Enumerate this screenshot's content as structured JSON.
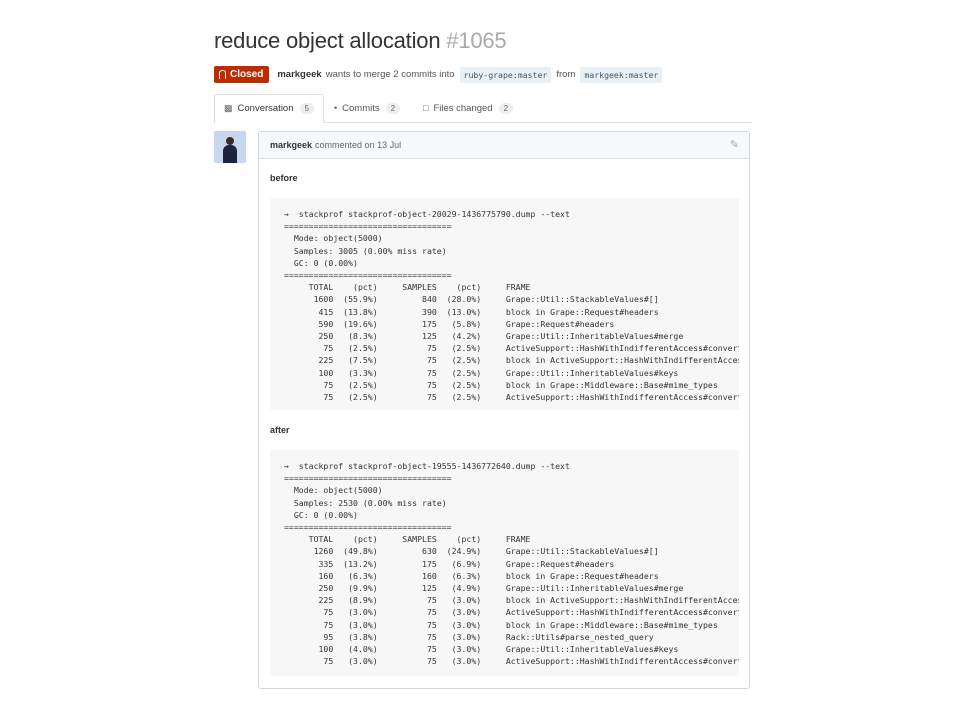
{
  "pr": {
    "title": "reduce object allocation",
    "number": "#1065",
    "state": "Closed",
    "author": "markgeek",
    "action_text": "wants to merge 2 commits into",
    "base_branch": "ruby-grape:master",
    "from_text": "from",
    "head_branch": "markgeek:master"
  },
  "tabs": [
    {
      "icon": "conversation-icon",
      "label": "Conversation",
      "count": "5"
    },
    {
      "icon": "commits-icon",
      "label": "Commits",
      "count": "2"
    },
    {
      "icon": "files-changed-icon",
      "label": "Files changed",
      "count": "2"
    }
  ],
  "comment": {
    "author": "markgeek",
    "date_text": "commented on 13 Jul",
    "before_label": "before",
    "after_label": "after",
    "before_code": "→  stackprof stackprof-object-20029-1436775790.dump --text\n==================================\n  Mode: object(5000)\n  Samples: 3005 (0.00% miss rate)\n  GC: 0 (0.00%)\n==================================\n     TOTAL    (pct)     SAMPLES    (pct)     FRAME\n      1600  (55.9%)         840  (28.0%)     Grape::Util::StackableValues#[]\n       415  (13.8%)         390  (13.0%)     block in Grape::Request#headers\n       590  (19.6%)         175   (5.8%)     Grape::Request#headers\n       250   (8.3%)         125   (4.2%)     Grape::Util::InheritableValues#merge\n        75   (2.5%)          75   (2.5%)     ActiveSupport::HashWithIndifferentAccess#convert_key\n       225   (7.5%)          75   (2.5%)     block in ActiveSupport::HashWithIndifferentAccess#update\n       100   (3.3%)          75   (2.5%)     Grape::Util::InheritableValues#keys\n        75   (2.5%)          75   (2.5%)     block in Grape::Middleware::Base#mime_types\n        75   (2.5%)          75   (2.5%)     ActiveSupport::HashWithIndifferentAccess#convert_value",
    "after_code": "→  stackprof stackprof-object-19555-1436772640.dump --text\n==================================\n  Mode: object(5000)\n  Samples: 2530 (0.00% miss rate)\n  GC: 0 (0.00%)\n==================================\n     TOTAL    (pct)     SAMPLES    (pct)     FRAME\n      1260  (49.8%)         630  (24.9%)     Grape::Util::StackableValues#[]\n       335  (13.2%)         175   (6.9%)     Grape::Request#headers\n       160   (6.3%)         160   (6.3%)     block in Grape::Request#headers\n       250   (9.9%)         125   (4.9%)     Grape::Util::InheritableValues#merge\n       225   (8.9%)          75   (3.0%)     block in ActiveSupport::HashWithIndifferentAccess#update\n        75   (3.0%)          75   (3.0%)     ActiveSupport::HashWithIndifferentAccess#convert_key\n        75   (3.0%)          75   (3.0%)     block in Grape::Middleware::Base#mime_types\n        95   (3.8%)          75   (3.0%)     Rack::Utils#parse_nested_query\n       100   (4.0%)          75   (3.0%)     Grape::Util::InheritableValues#keys\n        75   (3.0%)          75   (3.0%)     ActiveSupport::HashWithIndifferentAccess#convert_value"
  },
  "colors": {
    "closed_badge": "#bd2c00",
    "branch_bg": "#e8f1f8",
    "comment_header_bg": "#f5f9fc",
    "code_bg": "#f7f7f7"
  }
}
